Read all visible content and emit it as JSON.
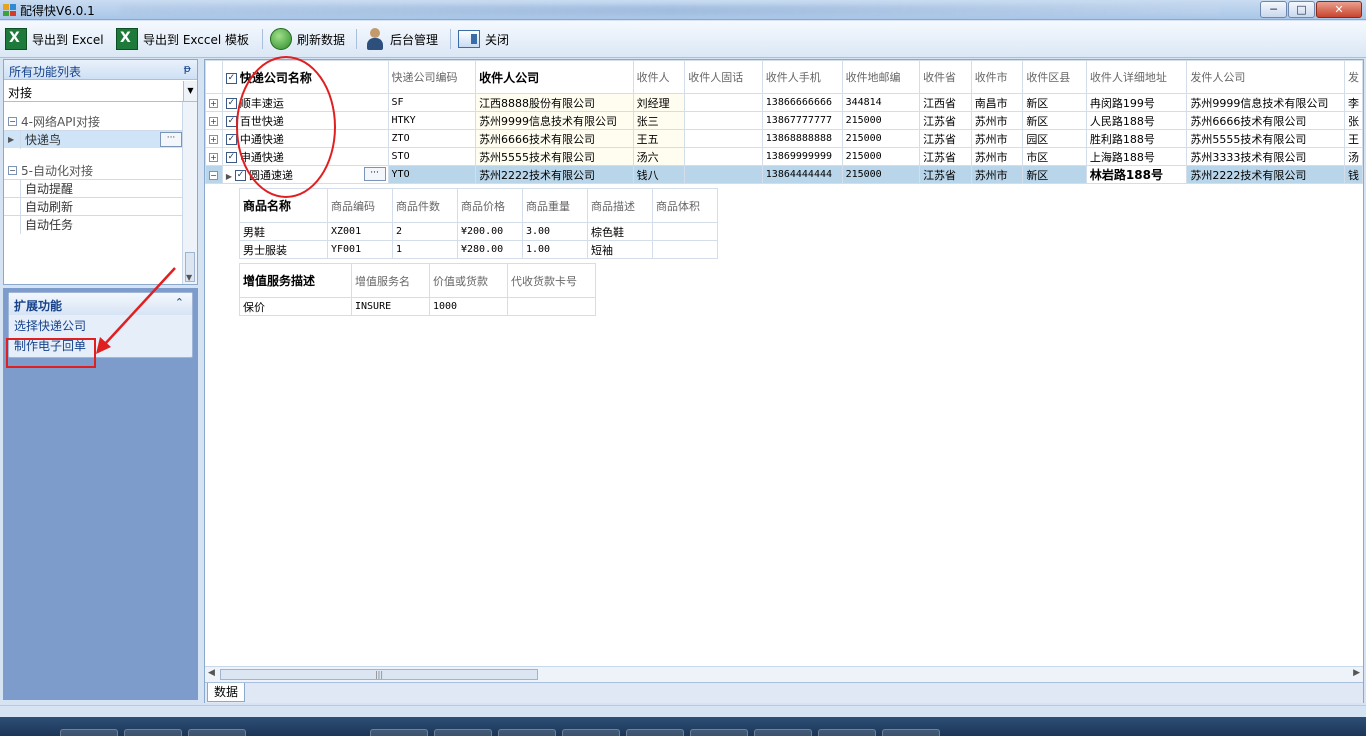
{
  "window": {
    "title": "配得快V6.0.1",
    "min_glyph": "─",
    "max_glyph": "□",
    "close_glyph": "✕"
  },
  "toolbar": {
    "export_excel": "导出到 Excel",
    "export_template": "导出到 Exccel 模板",
    "refresh": "刷新数据",
    "admin": "后台管理",
    "close": "关闭"
  },
  "sidebar": {
    "header": "所有功能列表",
    "pin_glyph": "ᵽ",
    "filter_value": "对接",
    "group1": {
      "title": "4-网络API对接",
      "items": [
        {
          "label": "快递鸟"
        }
      ]
    },
    "group2": {
      "title": "5-自动化对接",
      "items": [
        {
          "label": "自动提醒"
        },
        {
          "label": "自动刷新"
        },
        {
          "label": "自动任务"
        }
      ]
    }
  },
  "extensions": {
    "header": "扩展功能",
    "items": [
      {
        "label": "选择快递公司"
      },
      {
        "label": "制作电子回单"
      }
    ]
  },
  "grid": {
    "columns": [
      "快递公司名称",
      "快递公司编码",
      "收件人公司",
      "收件人",
      "收件人固话",
      "收件人手机",
      "收件地邮编",
      "收件省",
      "收件市",
      "收件区县",
      "收件人详细地址",
      "发件人公司",
      "发"
    ],
    "rows": [
      {
        "name": "顺丰速运",
        "code": "SF",
        "company": "江西8888股份有限公司",
        "person": "刘经理",
        "phone": "",
        "mobile": "13866666666",
        "zip": "344814",
        "prov": "江西省",
        "city": "南昌市",
        "district": "新区",
        "address": "冉闵路199号",
        "sender": "苏州9999信息技术有限公司",
        "extra": "李"
      },
      {
        "name": "百世快递",
        "code": "HTKY",
        "company": "苏州9999信息技术有限公司",
        "person": "张三",
        "phone": "",
        "mobile": "13867777777",
        "zip": "215000",
        "prov": "江苏省",
        "city": "苏州市",
        "district": "新区",
        "address": "人民路188号",
        "sender": "苏州6666技术有限公司",
        "extra": "张"
      },
      {
        "name": "中通快递",
        "code": "ZTO",
        "company": "苏州6666技术有限公司",
        "person": "王五",
        "phone": "",
        "mobile": "13868888888",
        "zip": "215000",
        "prov": "江苏省",
        "city": "苏州市",
        "district": "园区",
        "address": "胜利路188号",
        "sender": "苏州5555技术有限公司",
        "extra": "王"
      },
      {
        "name": "申通快递",
        "code": "STO",
        "company": "苏州5555技术有限公司",
        "person": "汤六",
        "phone": "",
        "mobile": "13869999999",
        "zip": "215000",
        "prov": "江苏省",
        "city": "苏州市",
        "district": "市区",
        "address": "上海路188号",
        "sender": "苏州3333技术有限公司",
        "extra": "汤"
      },
      {
        "name": "圆通速递",
        "code": "YTO",
        "company": "苏州2222技术有限公司",
        "person": "钱八",
        "phone": "",
        "mobile": "13864444444",
        "zip": "215000",
        "prov": "江苏省",
        "city": "苏州市",
        "district": "新区",
        "address": "林岩路188号",
        "sender": "苏州2222技术有限公司",
        "extra": "钱"
      }
    ]
  },
  "goods": {
    "columns": [
      "商品名称",
      "商品编码",
      "商品件数",
      "商品价格",
      "商品重量",
      "商品描述",
      "商品体积"
    ],
    "rows": [
      [
        "男鞋",
        "XZ001",
        "2",
        "¥200.00",
        "3.00",
        "棕色鞋",
        ""
      ],
      [
        "男士服装",
        "YF001",
        "1",
        "¥280.00",
        "1.00",
        "短袖",
        ""
      ]
    ]
  },
  "services": {
    "columns": [
      "增值服务描述",
      "增值服务名",
      "价值或货款",
      "代收货款卡号"
    ],
    "rows": [
      [
        "保价",
        "INSURE",
        "1000",
        ""
      ]
    ]
  },
  "tabs": {
    "data": "数据"
  },
  "glyphs": {
    "check": "✓",
    "plus": "+",
    "minus": "−",
    "ellipsis": "···",
    "row_arrow": "▶",
    "collapse": "⌃",
    "drop": "▼",
    "hthumb": "|||",
    "left": "◀",
    "right": "▶"
  }
}
